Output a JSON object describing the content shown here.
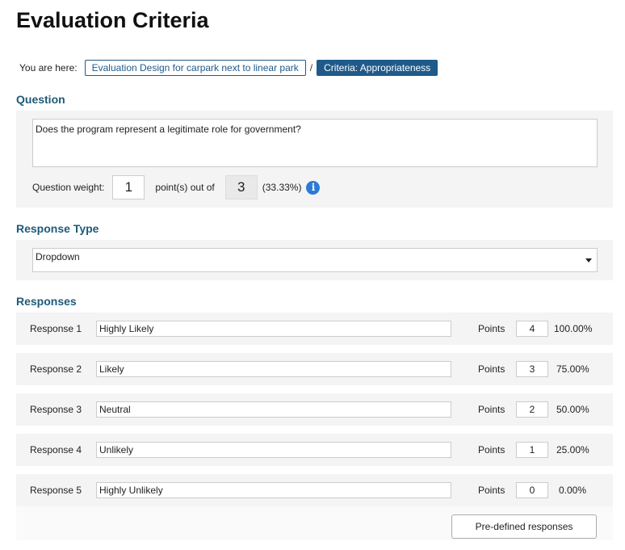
{
  "page": {
    "title": "Evaluation Criteria"
  },
  "breadcrumb": {
    "label": "You are here:",
    "link": "Evaluation Design for carpark next to linear park",
    "separator": "/",
    "current": "Criteria: Appropriateness"
  },
  "question": {
    "heading": "Question",
    "text": "Does the program represent a legitimate role for government?",
    "weight_label": "Question weight:",
    "weight_value": "1",
    "out_of_label": "point(s) out of",
    "total_points": "3",
    "percentage": "(33.33%)",
    "info_icon": "info-icon",
    "info_glyph": "i"
  },
  "response_type": {
    "heading": "Response Type",
    "selected": "Dropdown"
  },
  "responses": {
    "heading": "Responses",
    "points_label": "Points",
    "items": [
      {
        "label": "Response 1",
        "value": "Highly Likely",
        "points": "4",
        "percent": "100.00%"
      },
      {
        "label": "Response 2",
        "value": "Likely",
        "points": "3",
        "percent": "75.00%"
      },
      {
        "label": "Response 3",
        "value": "Neutral",
        "points": "2",
        "percent": "50.00%"
      },
      {
        "label": "Response 4",
        "value": "Unlikely",
        "points": "1",
        "percent": "25.00%"
      },
      {
        "label": "Response 5",
        "value": "Highly Unlikely",
        "points": "0",
        "percent": "0.00%"
      }
    ],
    "predefined_button": "Pre-defined responses"
  }
}
